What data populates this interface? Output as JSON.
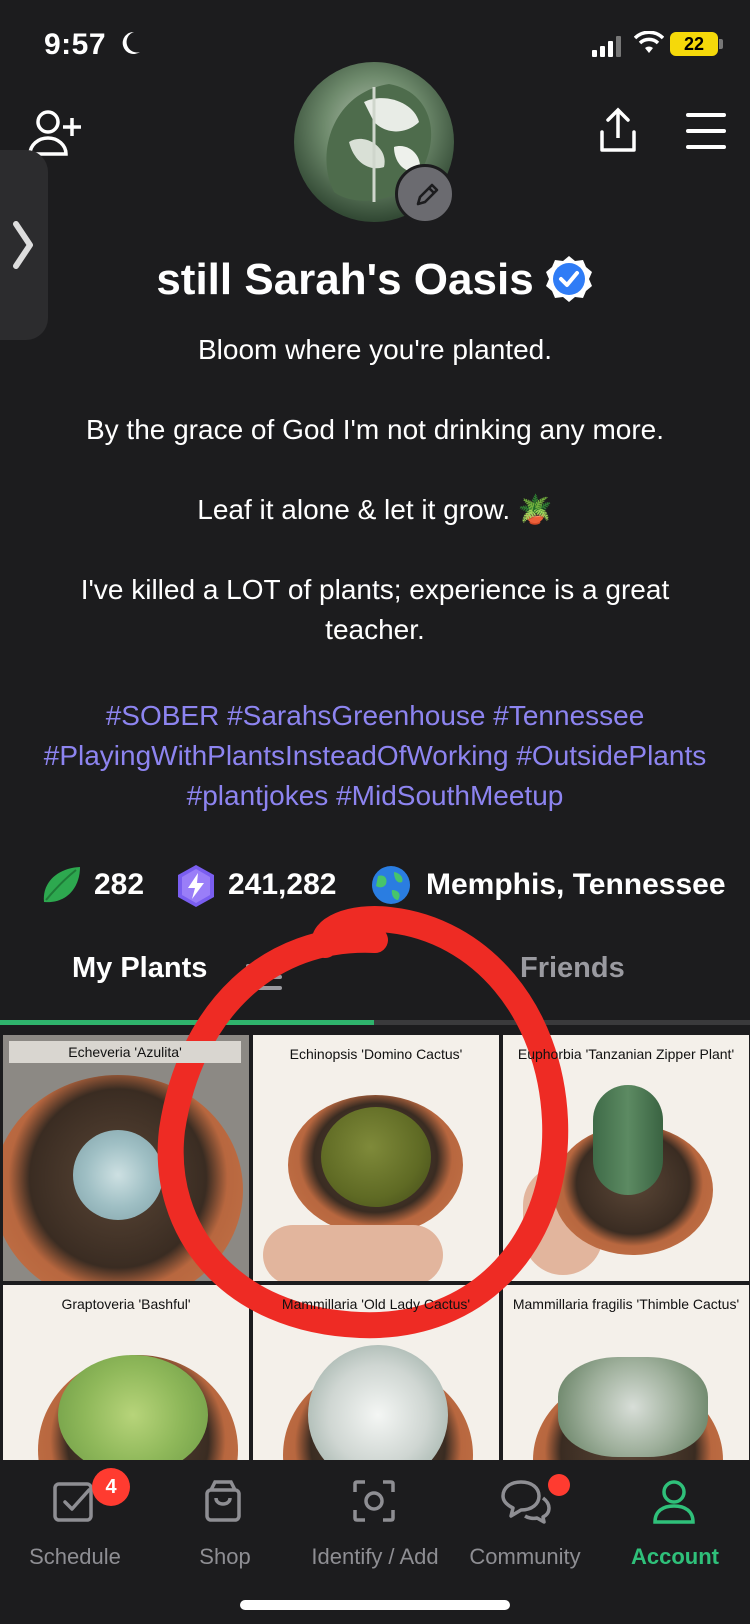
{
  "status_bar": {
    "time": "9:57",
    "battery": "22"
  },
  "profile": {
    "name": "still Sarah's Oasis",
    "bio": [
      "Bloom where you're planted.",
      "By the grace of God I'm not drinking any more.",
      "Leaf it alone & let it grow. 🪴",
      "I've killed a LOT of plants; experience is a great teacher."
    ],
    "hashtags": "#SOBER #SarahsGreenhouse #Tennessee #PlayingWithPlantsInsteadOfWorking #OutsidePlants #plantjokes #MidSouthMeetup",
    "stats": {
      "plants": "282",
      "points": "241,282",
      "location": "Memphis, Tennessee"
    }
  },
  "tabs": {
    "my_plants": "My Plants",
    "friends": "Friends"
  },
  "plants": [
    {
      "name": "Echeveria 'Azulita'"
    },
    {
      "name": "Echinopsis 'Domino Cactus'"
    },
    {
      "name": "Euphorbia 'Tanzanian Zipper Plant'"
    },
    {
      "name": "Graptoveria 'Bashful'"
    },
    {
      "name": "Mammillaria 'Old Lady Cactus'"
    },
    {
      "name": "Mammillaria fragilis 'Thimble Cactus'"
    }
  ],
  "bottom_nav": {
    "schedule": "Schedule",
    "schedule_badge": "4",
    "shop": "Shop",
    "identify": "Identify / Add",
    "community": "Community",
    "account": "Account"
  },
  "colors": {
    "accent": "#2fc07a",
    "hashtag": "#8d84f0",
    "badge": "#ff3b30",
    "annotation": "#ee2b24"
  }
}
